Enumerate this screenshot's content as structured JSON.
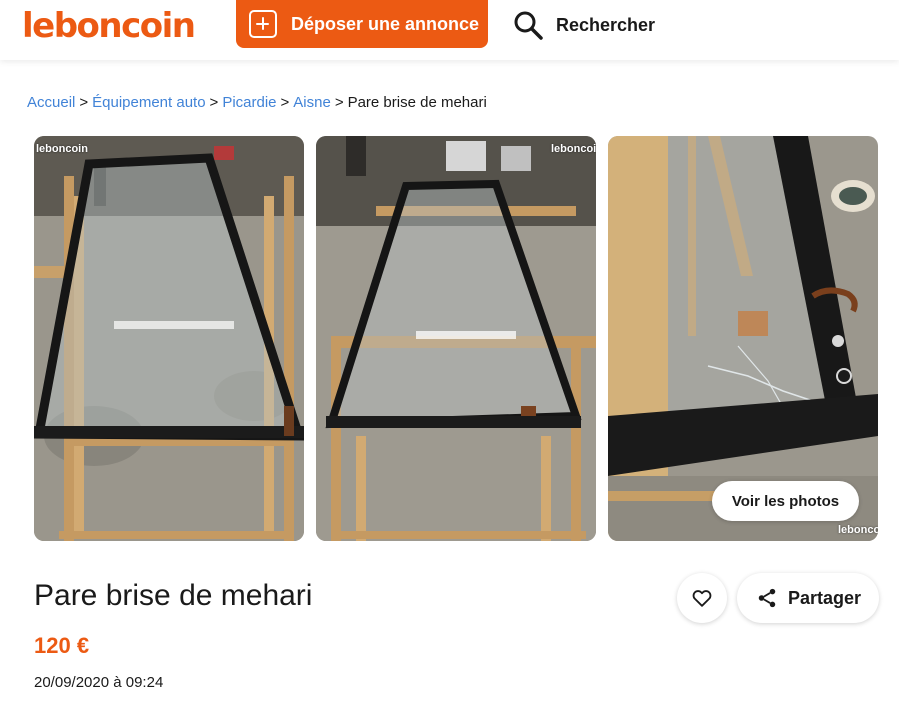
{
  "header": {
    "logo": "leboncoin",
    "post_ad_label": "Déposer une annonce",
    "search_label": "Rechercher"
  },
  "breadcrumb": {
    "items": [
      "Accueil",
      "Équipement auto",
      "Picardie",
      "Aisne"
    ],
    "current": "Pare brise de mehari",
    "separator": ">"
  },
  "gallery": {
    "watermark": "leboncoin",
    "see_photos_label": "Voir les photos"
  },
  "listing": {
    "title": "Pare brise de mehari",
    "price": "120 €",
    "date": "20/09/2020 à 09:24"
  },
  "actions": {
    "share_label": "Partager"
  },
  "colors": {
    "brand": "#ec5a13",
    "link": "#4183d7",
    "text": "#1a1a1a"
  },
  "icons": {
    "post": "plus-square-icon",
    "search": "search-icon",
    "favorite": "heart-icon",
    "share": "share-icon"
  }
}
